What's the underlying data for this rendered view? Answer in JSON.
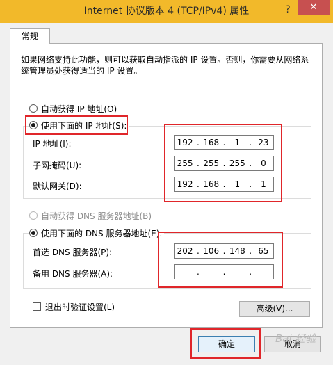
{
  "window": {
    "title": "Internet 协议版本 4 (TCP/IPv4) 属性",
    "help_symbol": "?",
    "close_symbol": "✕"
  },
  "tabs": [
    {
      "label": "常规",
      "selected": true
    }
  ],
  "description": "如果网络支持此功能，则可以获取自动指派的 IP 设置。否则，你需要从网络系统管理员处获得适当的 IP 设置。",
  "ip_section": {
    "auto_label": "自动获得 IP 地址(O)",
    "manual_label": "使用下面的 IP 地址(S):",
    "selected": "manual",
    "fields": [
      {
        "label": "IP 地址(I):",
        "octets": [
          "192",
          "168",
          "1",
          "23"
        ]
      },
      {
        "label": "子网掩码(U):",
        "octets": [
          "255",
          "255",
          "255",
          "0"
        ]
      },
      {
        "label": "默认网关(D):",
        "octets": [
          "192",
          "168",
          "1",
          "1"
        ]
      }
    ]
  },
  "dns_section": {
    "auto_label": "自动获得 DNS 服务器地址(B)",
    "manual_label": "使用下面的 DNS 服务器地址(E):",
    "selected": "manual",
    "fields": [
      {
        "label": "首选 DNS 服务器(P):",
        "octets": [
          "202",
          "106",
          "148",
          "65"
        ]
      },
      {
        "label": "备用 DNS 服务器(A):",
        "octets": [
          "",
          "",
          "",
          ""
        ]
      }
    ]
  },
  "validate_checkbox": {
    "label": "退出时验证设置(L)",
    "checked": false
  },
  "buttons": {
    "advanced": "高级(V)...",
    "ok": "确定",
    "cancel": "取消"
  },
  "watermark": "Bai 经验"
}
